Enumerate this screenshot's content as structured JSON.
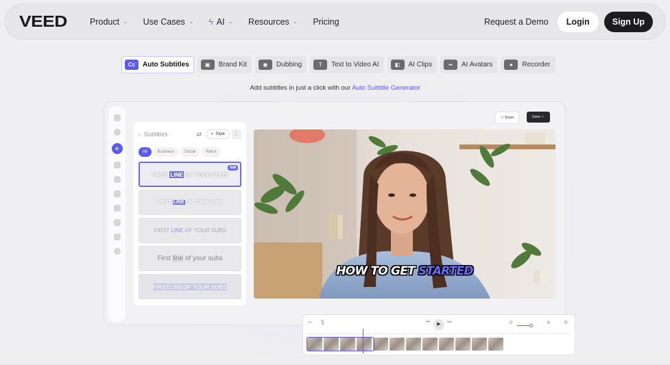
{
  "header": {
    "logo": "VEED",
    "nav": [
      {
        "label": "Product",
        "chevron": true,
        "spark": false
      },
      {
        "label": "Use Cases",
        "chevron": true,
        "spark": false
      },
      {
        "label": "AI",
        "chevron": true,
        "spark": true
      },
      {
        "label": "Resources",
        "chevron": true,
        "spark": false
      },
      {
        "label": "Pricing",
        "chevron": false,
        "spark": false
      }
    ],
    "request_demo": "Request a Demo",
    "login": "Login",
    "signup": "Sign Up"
  },
  "tabs": [
    {
      "label": "Auto Subtitles",
      "icon": "Cc",
      "active": true
    },
    {
      "label": "Brand Kit",
      "icon": "▣",
      "active": false
    },
    {
      "label": "Dubbing",
      "icon": "◉",
      "active": false
    },
    {
      "label": "Text to Video AI",
      "icon": "T",
      "active": false
    },
    {
      "label": "AI Clips",
      "icon": "◧",
      "active": false
    },
    {
      "label": "AI Avatars",
      "icon": "▪▪",
      "active": false
    },
    {
      "label": "Recorder",
      "icon": "●",
      "active": false
    }
  ],
  "tagline": {
    "text": "Add subtitles in just a click with our ",
    "link": "Auto Subtitle Generator"
  },
  "editor": {
    "panel_title": "Subtitles",
    "style_button": "Style",
    "filters": [
      "All",
      "Business",
      "Social",
      "Retro"
    ],
    "edit_badge": "Edit",
    "presets": [
      {
        "before": "FIRST ",
        "highlight": "LINE",
        "after": " OF YOUR SUBS"
      },
      {
        "before": "FIRST ",
        "highlight": "LINE",
        "after": " OF YOUR SUBS"
      },
      {
        "before": "FIRST ",
        "highlight": "LINE",
        "after": " OF YOUR SUBS"
      },
      {
        "before": "First ",
        "highlight": "line",
        "after": " of your subs"
      },
      {
        "before": "FIRST ",
        "highlight": "LINE",
        "after": " OF YOUR SUBS"
      }
    ],
    "share": "Share",
    "done": "Done",
    "caption_main": "HOW TO GET ",
    "caption_accent": "STARTED"
  },
  "colors": {
    "accent": "#5b5bf0",
    "dark": "#1c1c1f",
    "background": "#efeff1"
  }
}
